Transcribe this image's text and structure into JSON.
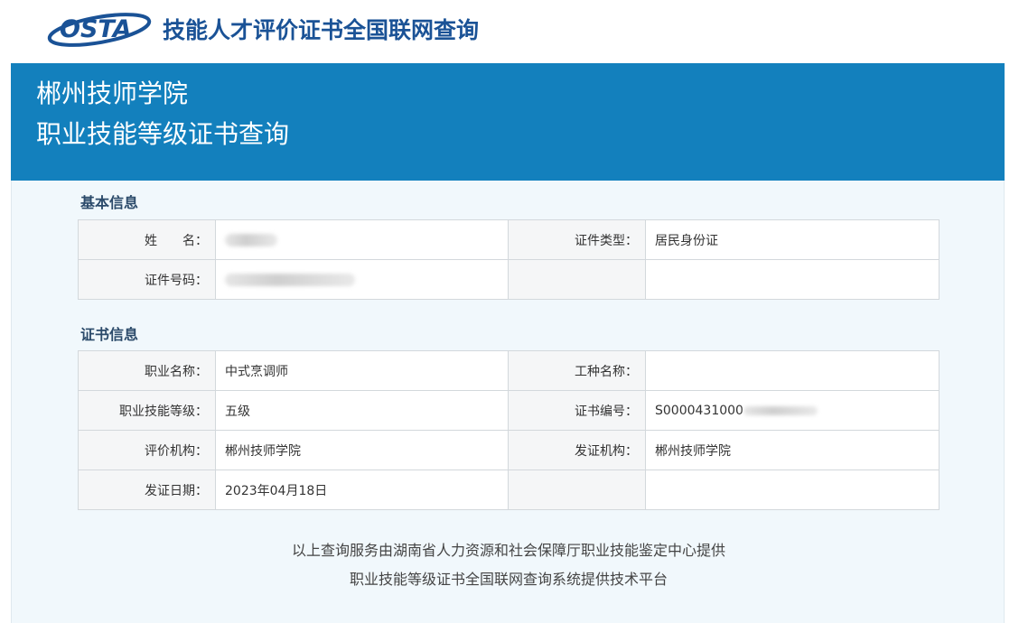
{
  "header": {
    "logo_text": "OSTA",
    "site_title": "技能人才评价证书全国联网查询",
    "brand_color": "#1a5296"
  },
  "banner": {
    "line1": "郴州技师学院",
    "line2": "职业技能等级证书查询",
    "bg_color": "#1380bd"
  },
  "basic_info": {
    "title": "基本信息",
    "name_label": "姓　　名：",
    "name_value": "",
    "id_type_label": "证件类型：",
    "id_type_value": "居民身份证",
    "id_number_label": "证件号码：",
    "id_number_value": ""
  },
  "cert_info": {
    "title": "证书信息",
    "occupation_label": "职业名称：",
    "occupation_value": "中式烹调师",
    "job_type_label": "工种名称：",
    "job_type_value": "",
    "level_label": "职业技能等级：",
    "level_value": "五级",
    "cert_no_label": "证书编号：",
    "cert_no_value": "S0000431000",
    "evaluator_label": "评价机构：",
    "evaluator_value": "郴州技师学院",
    "issuer_label": "发证机构：",
    "issuer_value": "郴州技师学院",
    "issue_date_label": "发证日期：",
    "issue_date_value": "2023年04月18日"
  },
  "footer": {
    "line1": "以上查询服务由湖南省人力资源和社会保障厅职业技能鉴定中心提供",
    "line2": "职业技能等级证书全国联网查询系统提供技术平台"
  }
}
